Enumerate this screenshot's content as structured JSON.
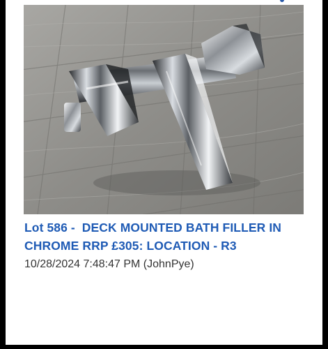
{
  "lot": {
    "title": "Lot 586 -  DECK MOUNTED BATH FILLER IN CHROME RRP £305: LOCATION - R3",
    "timestamp": "10/28/2024 7:48:47 PM (JohnPye)"
  },
  "image": {
    "subject": "chrome deck mounted bath filler tap on grey wood-effect floor"
  },
  "colors": {
    "title": "#1f5bb5",
    "text": "#333333",
    "background": "#ffffff",
    "frame": "#000000"
  }
}
